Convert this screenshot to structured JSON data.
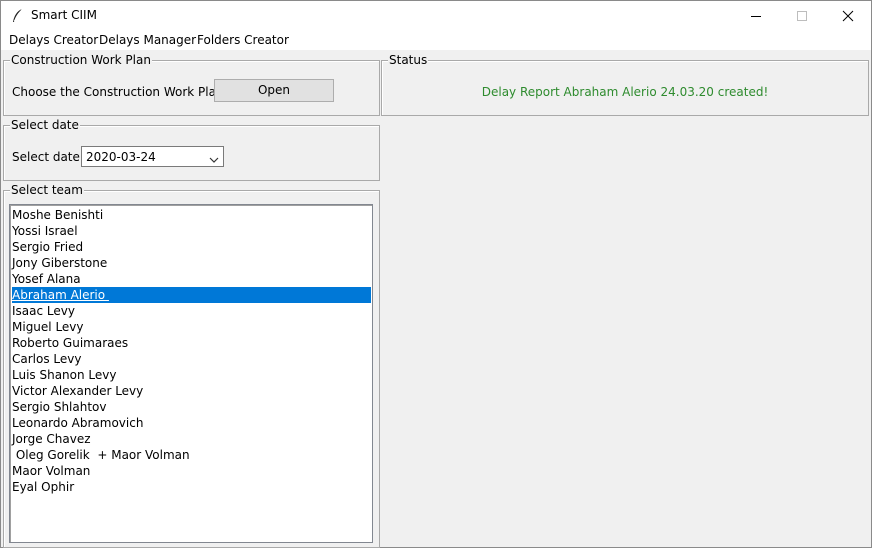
{
  "window": {
    "title": "Smart CIIM",
    "icon": "feather-icon"
  },
  "menu": [
    "Delays Creator",
    "Delays Manager",
    "Folders Creator"
  ],
  "construction_work_plan": {
    "frame_title": "Construction Work Plan",
    "label": "Choose the Construction Work Plan:",
    "button": "Open"
  },
  "status": {
    "frame_title": "Status",
    "message": "Delay Report Abraham Alerio 24.03.20 created!",
    "message_color": "#2e8b2e"
  },
  "date": {
    "frame_title": "Select date",
    "label": "Select date:",
    "value": "2020-03-24"
  },
  "team": {
    "frame_title": "Select team",
    "selected_index": 5,
    "selection_color": "#0078d7",
    "members": [
      "Moshe Benishti",
      "Yossi Israel",
      "Sergio Fried",
      "Jony Giberstone",
      "Yosef Alana",
      "Abraham Alerio ",
      "Isaac Levy",
      "Miguel Levy",
      "Roberto Guimaraes",
      "Carlos Levy",
      "Luis Shanon Levy",
      "Victor Alexander Levy",
      "Sergio Shlahtov",
      "Leonardo Abramovich",
      "Jorge Chavez",
      " Oleg Gorelik  + Maor Volman",
      "Maor Volman",
      "Eyal Ophir"
    ]
  }
}
